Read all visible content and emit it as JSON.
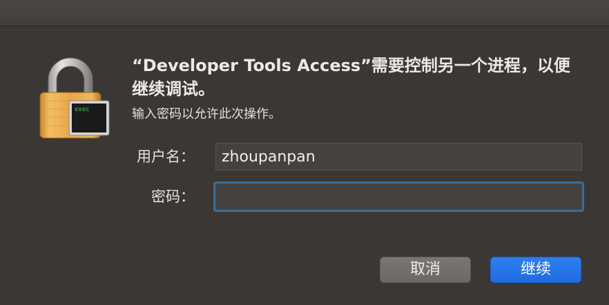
{
  "dialog": {
    "title": "“Developer Tools Access”需要控制另一个进程，以便继续调试。",
    "subtitle": "输入密码以允许此次操作。",
    "icon": {
      "name": "lock-icon",
      "badge_text": "exec"
    }
  },
  "form": {
    "username_label": "用户名：",
    "username_value": "zhoupanpan",
    "password_label": "密码：",
    "password_value": ""
  },
  "buttons": {
    "cancel_label": "取消",
    "continue_label": "继续"
  },
  "colors": {
    "background": "#3b3735",
    "primary_button": "#1f6ce0",
    "focus_ring": "#3a6f98"
  }
}
